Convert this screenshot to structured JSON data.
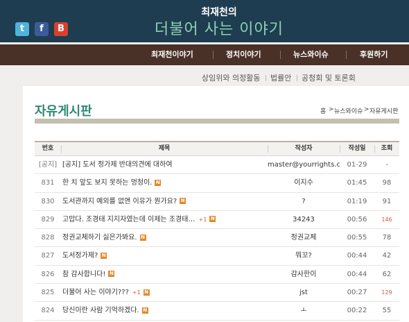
{
  "header": {
    "brand_sub": "최재천의",
    "brand_title": "더불어 사는 이야기",
    "social": {
      "twitter": "t",
      "facebook": "f",
      "blog": "B"
    }
  },
  "nav": [
    "최재천이야기",
    "정치이야기",
    "뉴스와이슈",
    "후원하기"
  ],
  "subnav": [
    "상임위와 의정활동",
    "법률안",
    "공청회 및 토론회"
  ],
  "page": {
    "title": "자유게시판",
    "breadcrumb": [
      "홈",
      "뉴스와이슈",
      "자유게시판"
    ]
  },
  "table": {
    "headers": {
      "num": "번호",
      "title": "제목",
      "author": "작성자",
      "date": "작성일",
      "views": "조회"
    },
    "rows": [
      {
        "num": "[공지]",
        "title": "[공지] 도서 정가제 반대의견에 대하여",
        "author": "master@yourrights.co…",
        "date": "01-29",
        "views": "-",
        "new": false,
        "comments": ""
      },
      {
        "num": "831",
        "title": "한 치 앞도 보지 못하는 멍청이.",
        "author": "이지수",
        "date": "01:45",
        "views": "98",
        "new": true,
        "comments": ""
      },
      {
        "num": "830",
        "title": "도서관까지 예외를 없앤 이유가 뭔가요?",
        "author": "?",
        "date": "01:19",
        "views": "91",
        "new": true,
        "comments": ""
      },
      {
        "num": "829",
        "title": "고맙다. 조경태 지지자였는데 이제는 조경태…",
        "author": "34243",
        "date": "00:56",
        "views": "146",
        "new": true,
        "comments": "+1"
      },
      {
        "num": "828",
        "title": "정권교체하기 싫은가봐요.",
        "author": "정권교체",
        "date": "00:55",
        "views": "78",
        "new": true,
        "comments": ""
      },
      {
        "num": "827",
        "title": "도서정가제?",
        "author": "뭐꼬?",
        "date": "00:44",
        "views": "42",
        "new": true,
        "comments": ""
      },
      {
        "num": "826",
        "title": "참 감사합니다!",
        "author": "감사한이",
        "date": "00:44",
        "views": "62",
        "new": true,
        "comments": ""
      },
      {
        "num": "825",
        "title": "더불어 사는 이야기???",
        "author": "jst",
        "date": "00:27",
        "views": "129",
        "new": true,
        "comments": "+1"
      },
      {
        "num": "824",
        "title": "당신이란 사람 기억하겠다.",
        "author": "ㅗ",
        "date": "00:22",
        "views": "55",
        "new": true,
        "comments": ""
      }
    ]
  },
  "colors": {
    "header_bg": "#1e3d50",
    "nav_bg": "#4a3127",
    "title_green": "#2e8775",
    "hot_red": "#d9572f"
  }
}
